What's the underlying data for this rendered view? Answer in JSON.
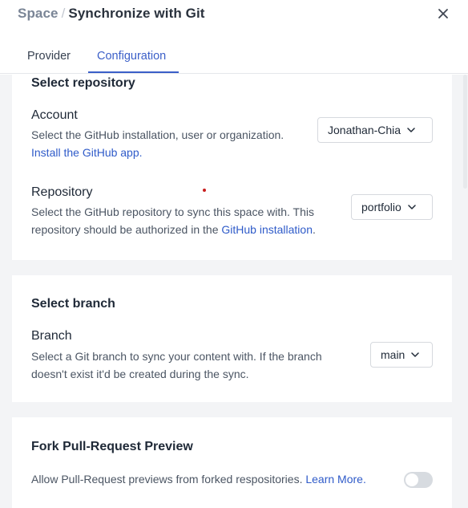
{
  "header": {
    "breadcrumb_parent": "Space",
    "breadcrumb_separator": "/",
    "title": "Synchronize with Git"
  },
  "tabs": [
    {
      "label": "Provider",
      "active": false
    },
    {
      "label": "Configuration",
      "active": true
    }
  ],
  "colors": {
    "accent": "#3b5fc8",
    "link": "#2f5bc9",
    "panel_bg": "#f3f4f6"
  },
  "repository_section": {
    "title": "Select repository",
    "account": {
      "label": "Account",
      "description": "Select the GitHub installation, user or organization.",
      "link": "Install the GitHub app.",
      "selected": "Jonathan-Chia"
    },
    "repository": {
      "label": "Repository",
      "description_line1": "Select the GitHub repository to sync this space with. This",
      "description_line2_prefix": "repository should be authorized in the ",
      "link": "GitHub installation",
      "description_line2_suffix": ".",
      "selected": "portfolio"
    }
  },
  "branch_section": {
    "title": "Select branch",
    "branch": {
      "label": "Branch",
      "description_line1": "Select a Git branch to sync your content with. If the branch",
      "description_line2": "doesn't exist it'd be created during the sync.",
      "selected": "main"
    }
  },
  "fork_section": {
    "title": "Fork Pull-Request Preview",
    "description": "Allow Pull-Request previews from forked respositories.",
    "link": "Learn More.",
    "toggle_on": false
  }
}
